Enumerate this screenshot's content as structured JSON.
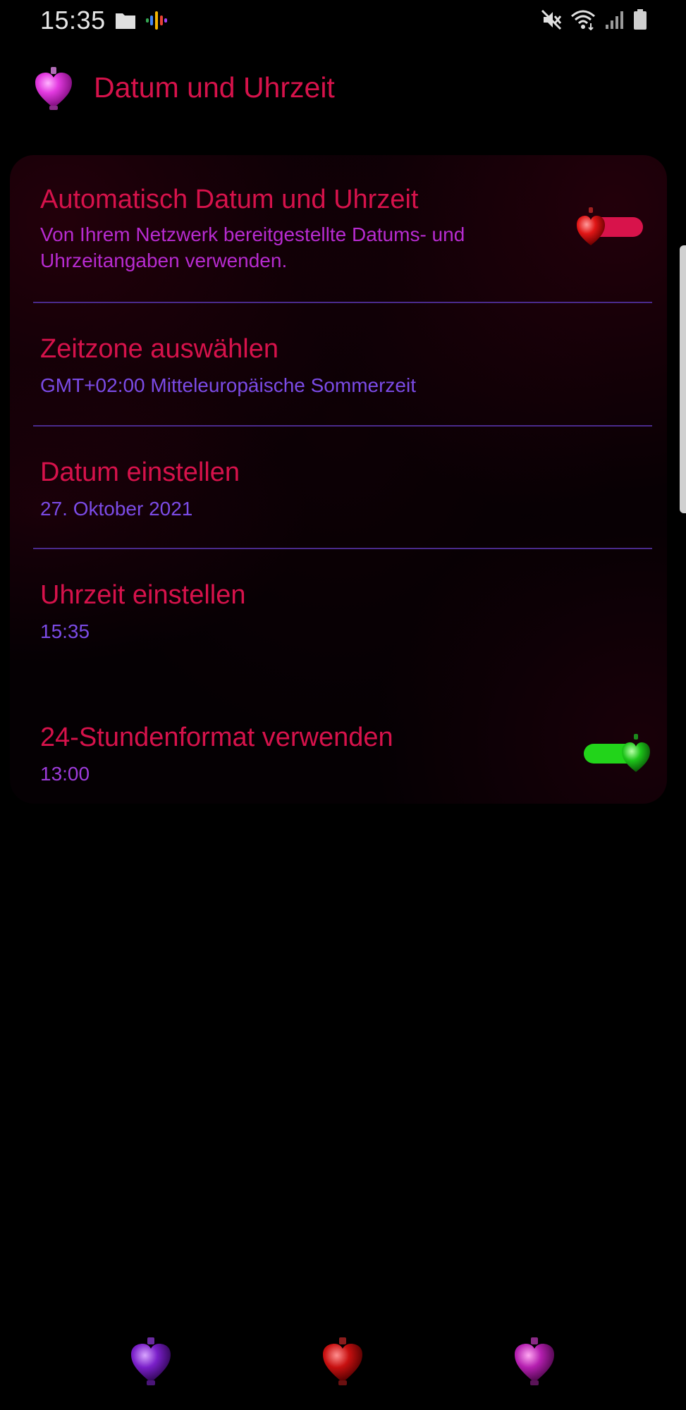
{
  "status_bar": {
    "time": "15:35",
    "left_icons": [
      "folder-icon",
      "podcast-icon"
    ],
    "right_icons": [
      "mute-icon",
      "wifi-icon",
      "signal-icon",
      "battery-icon"
    ]
  },
  "header": {
    "title": "Datum und Uhrzeit",
    "icon": "heart-bottle-icon"
  },
  "settings": [
    {
      "title": "Automatisch Datum und Uhrzeit",
      "subtitle_line1": "Von Ihrem Netzwerk bereitgestellte Datums- und",
      "subtitle_line2": "Uhrzeitangaben verwenden.",
      "toggle": "off"
    },
    {
      "title": "Zeitzone auswählen",
      "subtitle": "GMT+02:00 Mitteleuropäische Sommerzeit"
    },
    {
      "title": "Datum einstellen",
      "subtitle": "27. Oktober 2021"
    },
    {
      "title": "Uhrzeit einstellen",
      "subtitle": "15:35"
    },
    {
      "title": "24-Stundenformat verwenden",
      "subtitle": "13:00",
      "toggle": "on"
    }
  ],
  "nav_bar": [
    "recents-button",
    "home-button",
    "back-button"
  ],
  "colors": {
    "title_red": "#d6124b",
    "subtitle_magenta": "#b72bd0",
    "subtitle_violet": "#7b4be6",
    "divider": "#4a2a8c",
    "toggle_off": "#d8134b",
    "toggle_on": "#22d41a"
  }
}
